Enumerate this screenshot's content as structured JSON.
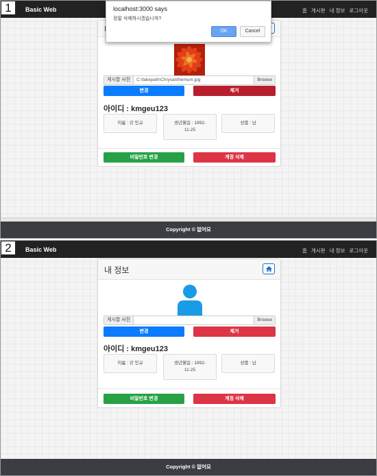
{
  "steps": [
    "1",
    "2"
  ],
  "navbar": {
    "brand": "Basic Web",
    "links": [
      "홈",
      "게시판",
      "내 정보",
      "로그아웃"
    ]
  },
  "footer": {
    "text": "Copyright © 없어요"
  },
  "card": {
    "title": "내 정보",
    "file_label": "게시할 사진",
    "file_value_before": "C:\\fakepath\\Chrysanthemum.jpg",
    "file_value_after": "",
    "browse_label": "Browse",
    "change_label": "변경",
    "remove_label": "제거",
    "user_id": "아이디 : kmgeu123",
    "name": "이름 : 강 민규",
    "birth_line1": "생년월일 : 1992-",
    "birth_line2": "11-25",
    "gender": "성별 : 남",
    "change_password_label": "비밀번호 변경",
    "delete_account_label": "계정 삭제"
  },
  "dialog": {
    "title": "localhost:3000 says",
    "message": "정말 삭제하시겠습니까?",
    "ok_label": "OK",
    "cancel_label": "Cancel"
  },
  "colors": {
    "navbar": "#222222",
    "footer": "#3a3d42",
    "primary": "#0b7bff",
    "danger": "#dc3545",
    "success": "#27a146",
    "avatar": "#1a9be6"
  }
}
